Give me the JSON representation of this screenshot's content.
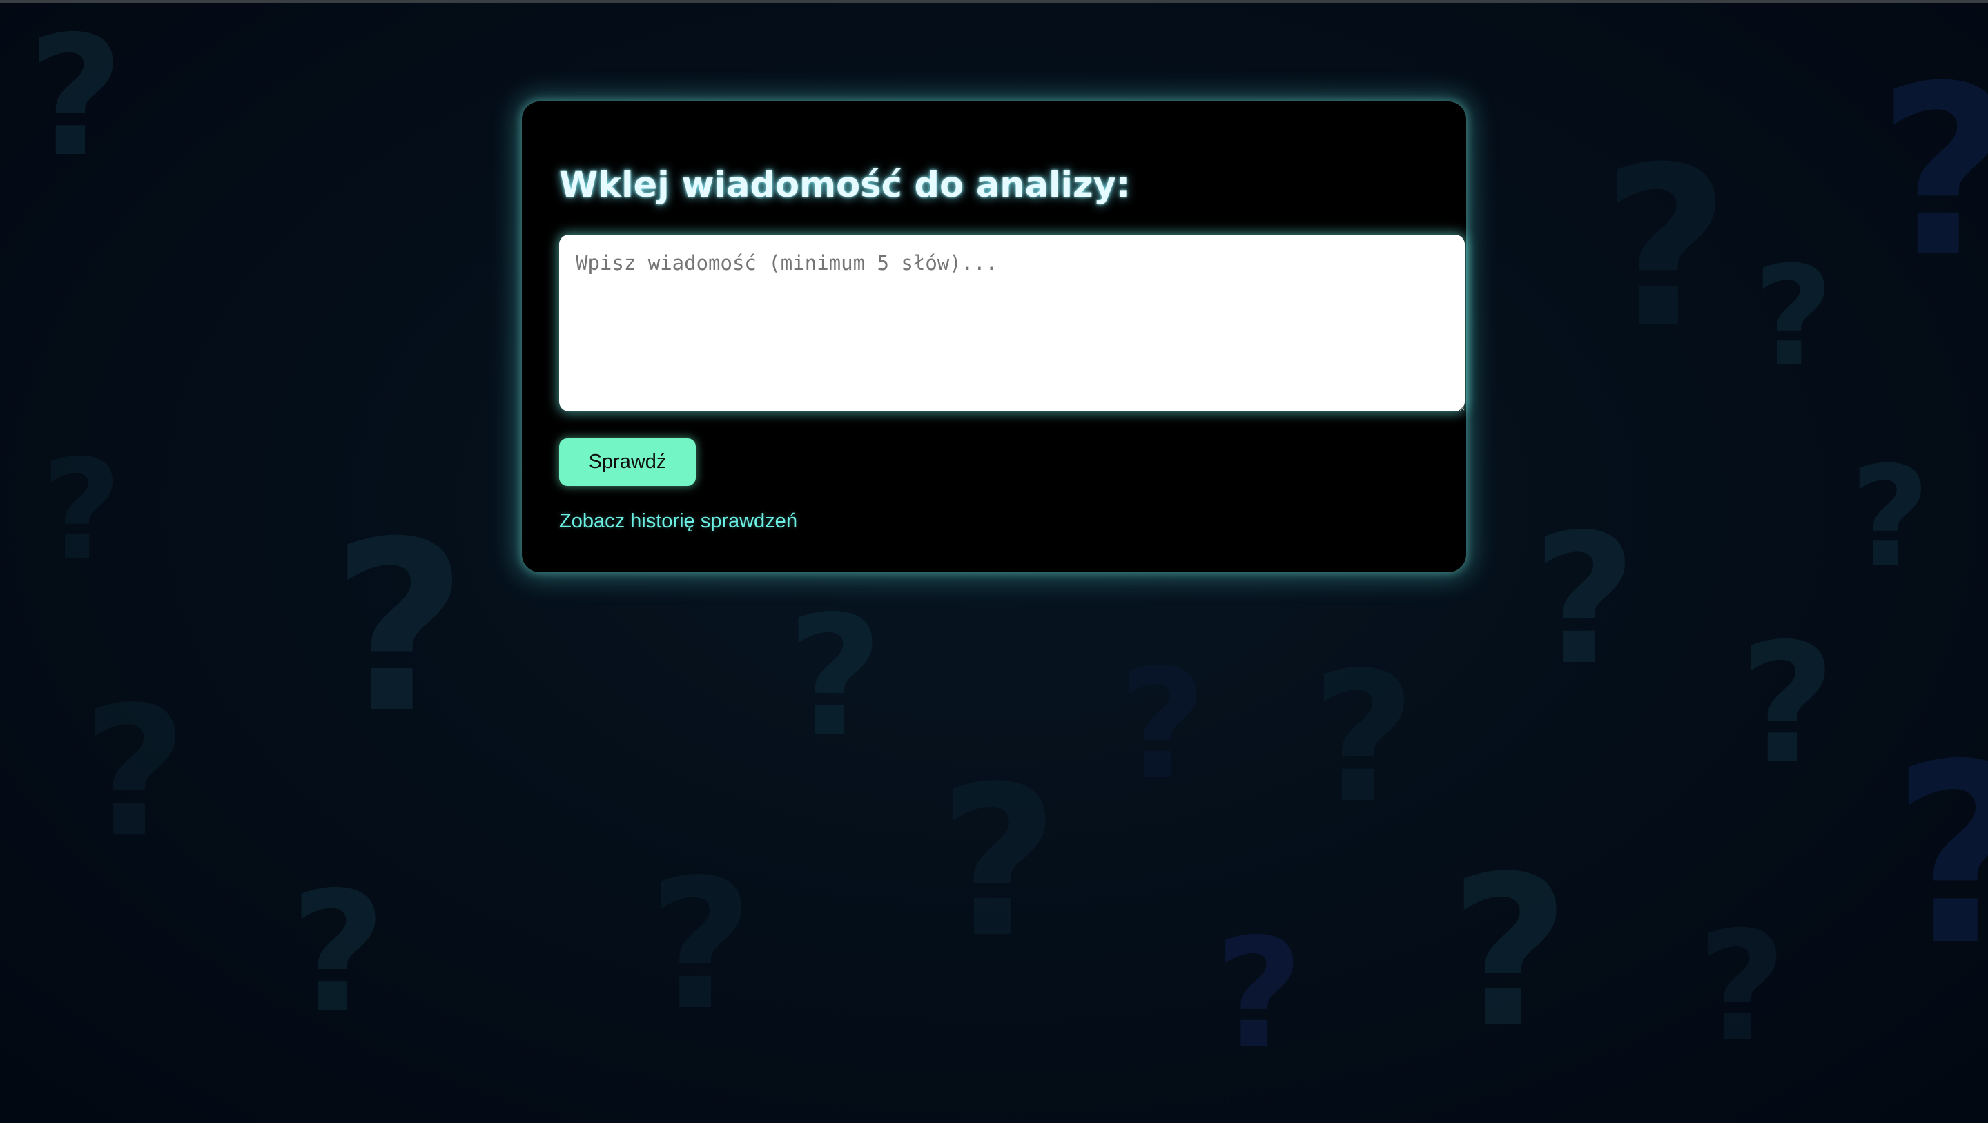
{
  "page": {
    "title": "Wklej wiadomość do analizy:",
    "message_input": {
      "placeholder": "Wpisz wiadomość (minimum 5 słów)...",
      "value": ""
    },
    "check_button": "Sprawdź",
    "history_link": "Zobacz historię sprawdzeń"
  },
  "background": {
    "pattern_icon": "question-mark-icon",
    "colors": {
      "base": "#040d18",
      "mark_teal": "#0f2c3a",
      "mark_blue": "#0c1a3c"
    }
  },
  "colors": {
    "card": "#000000",
    "glow": "#5ee0d6",
    "button": "#74f5c6",
    "link": "#6cf0e4",
    "title": "#e6fbff"
  }
}
